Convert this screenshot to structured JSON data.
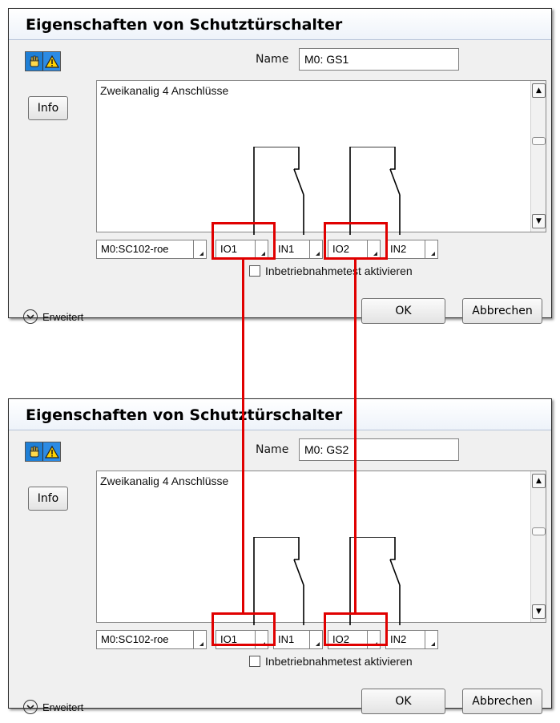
{
  "dialogs": [
    {
      "title": "Eigenschaften von Schutztürschalter",
      "name_label": "Name",
      "name_value": "M0: GS1",
      "info_label": "Info",
      "panel_text": "Zweikanalig 4 Anschlüsse",
      "combos": [
        "M0:SC102-roe",
        "IO1",
        "IN1",
        "IO2",
        "IN2"
      ],
      "checkbox_label": "Inbetriebnahmetest aktivieren",
      "expand_label": "Erweitert",
      "ok_label": "OK",
      "cancel_label": "Abbrechen"
    },
    {
      "title": "Eigenschaften von Schutztürschalter",
      "name_label": "Name",
      "name_value": "M0: GS2",
      "info_label": "Info",
      "panel_text": "Zweikanalig 4 Anschlüsse",
      "combos": [
        "M0:SC102-roe",
        "IO1",
        "IN1",
        "IO2",
        "IN2"
      ],
      "checkbox_label": "Inbetriebnahmetest aktivieren",
      "expand_label": "Erweitert",
      "ok_label": "OK",
      "cancel_label": "Abbrechen"
    }
  ],
  "colors": {
    "highlight": "#e00000",
    "mode_icon_blue": "#1e7fd6"
  },
  "icons": [
    "hand-icon",
    "warning-icon",
    "chevron-down-icon",
    "scroll-up-icon",
    "scroll-down-icon"
  ]
}
